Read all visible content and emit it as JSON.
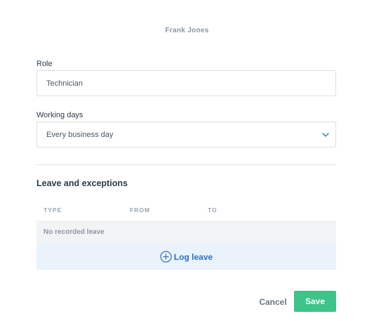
{
  "header": {
    "name": "Frank Jones"
  },
  "role": {
    "label": "Role",
    "value": "Technician"
  },
  "working_days": {
    "label": "Working days",
    "value": "Every business day"
  },
  "leave": {
    "title": "Leave and exceptions",
    "columns": [
      "TYPE",
      "FROM",
      "TO"
    ],
    "empty_text": "No recorded leave",
    "log_label": "Log leave"
  },
  "actions": {
    "cancel_label": "Cancel",
    "save_label": "Save"
  },
  "colors": {
    "accent": "#2f6fc2",
    "save": "#3cc489",
    "log_bg": "#eaf2fb"
  },
  "icons": {
    "select": "chevron-down-icon",
    "log": "plus-circle-icon"
  }
}
